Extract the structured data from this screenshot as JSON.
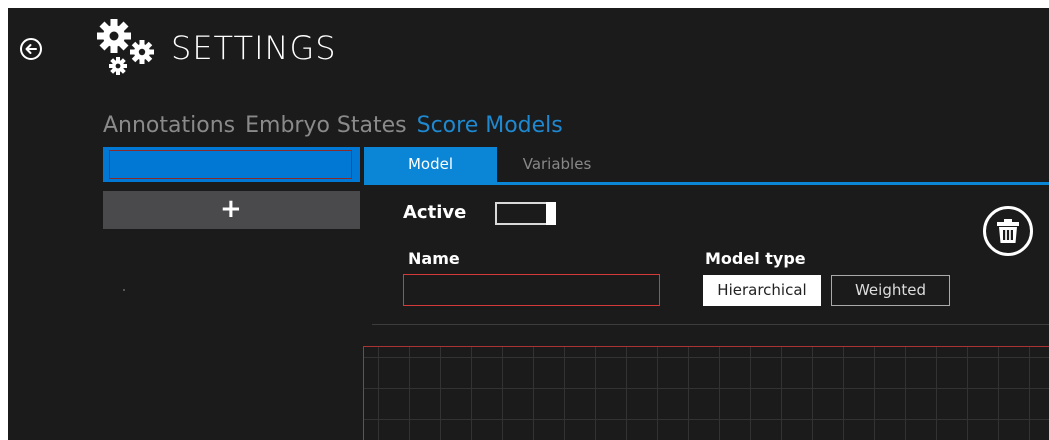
{
  "header": {
    "title": "SETTINGS"
  },
  "top_tabs": [
    {
      "label": "Annotations",
      "active": false
    },
    {
      "label": "Embryo States",
      "active": false
    },
    {
      "label": "Score Models",
      "active": true
    }
  ],
  "left_panel": {
    "add_label": "+"
  },
  "sub_tabs": [
    {
      "label": "Model",
      "active": true
    },
    {
      "label": "Variables",
      "active": false
    }
  ],
  "model_form": {
    "active_label": "Active",
    "active_value": true,
    "name_label": "Name",
    "name_value": "",
    "model_type_label": "Model type",
    "model_type_options": [
      "Hierarchical",
      "Weighted"
    ],
    "model_type_selected": "Hierarchical"
  },
  "colors": {
    "accent": "#0b86d6",
    "background": "#1b1b1b",
    "error_border": "#d43a3a"
  },
  "icons": {
    "back": "back-arrow-icon",
    "settings": "gears-icon",
    "delete": "trash-icon"
  }
}
